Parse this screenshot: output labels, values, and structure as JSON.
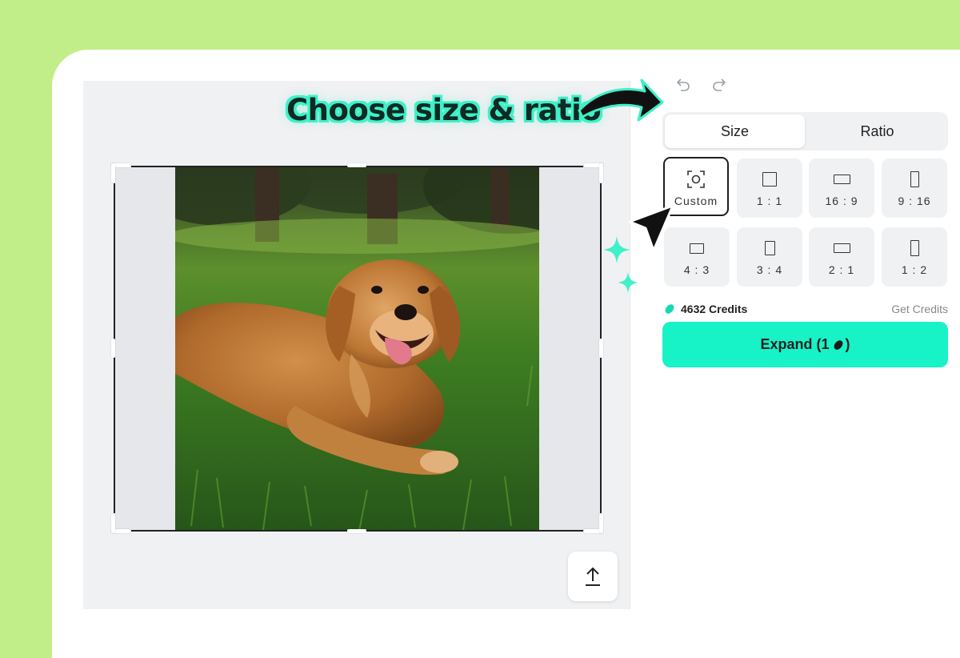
{
  "callout": {
    "text": "Choose size & ratio"
  },
  "history": {
    "undo_icon": "undo-icon",
    "redo_icon": "redo-icon"
  },
  "tabs": [
    {
      "label": "Size",
      "active": true
    },
    {
      "label": "Ratio",
      "active": false
    }
  ],
  "ratios": [
    {
      "label": "Custom",
      "icon": "custom-focus-icon",
      "selected": true
    },
    {
      "label": "1 : 1",
      "icon": "square-icon",
      "selected": false
    },
    {
      "label": "16 : 9",
      "icon": "landscape-wide-icon",
      "selected": false
    },
    {
      "label": "9 : 16",
      "icon": "portrait-tall-icon",
      "selected": false
    },
    {
      "label": "4 : 3",
      "icon": "landscape-icon",
      "selected": false
    },
    {
      "label": "3 : 4",
      "icon": "portrait-icon",
      "selected": false
    },
    {
      "label": "2 : 1",
      "icon": "landscape-wide-icon",
      "selected": false
    },
    {
      "label": "1 : 2",
      "icon": "portrait-tall-icon",
      "selected": false
    }
  ],
  "credits": {
    "amount": "4632 Credits",
    "icon": "credit-bean-icon",
    "get_label": "Get Credits"
  },
  "expand": {
    "label_prefix": "Expand (1",
    "label_suffix": ")",
    "icon": "credit-bean-icon"
  },
  "upload": {
    "icon": "upload-arrow-icon"
  },
  "colors": {
    "accent": "#17f3c7",
    "background": "#c2ee8a",
    "callout_outline": "#3ff0c8"
  }
}
